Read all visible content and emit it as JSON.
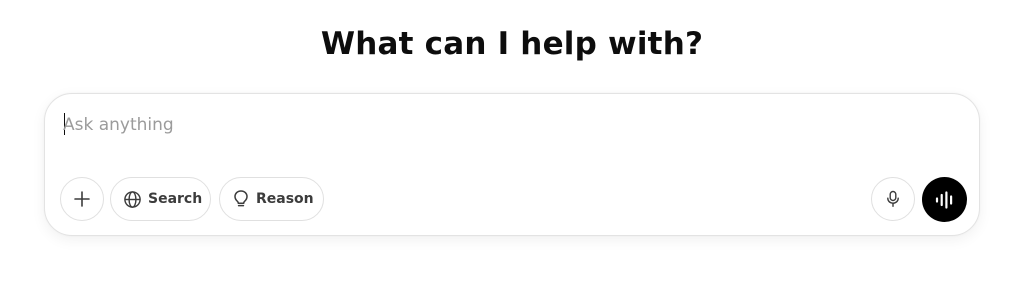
{
  "heading": "What can I help with?",
  "composer": {
    "placeholder": "Ask anything",
    "value": ""
  },
  "toolbar": {
    "plus_icon": "plus-icon",
    "search_label": "Search",
    "search_icon": "globe-icon",
    "reason_label": "Reason",
    "reason_icon": "lightbulb-icon",
    "mic_icon": "microphone-icon",
    "voice_icon": "voice-waveform-icon"
  },
  "colors": {
    "text": "#0d0d0d",
    "placeholder": "#9b9b9b",
    "border": "#e3e3e3",
    "voice_button_bg": "#000000"
  }
}
